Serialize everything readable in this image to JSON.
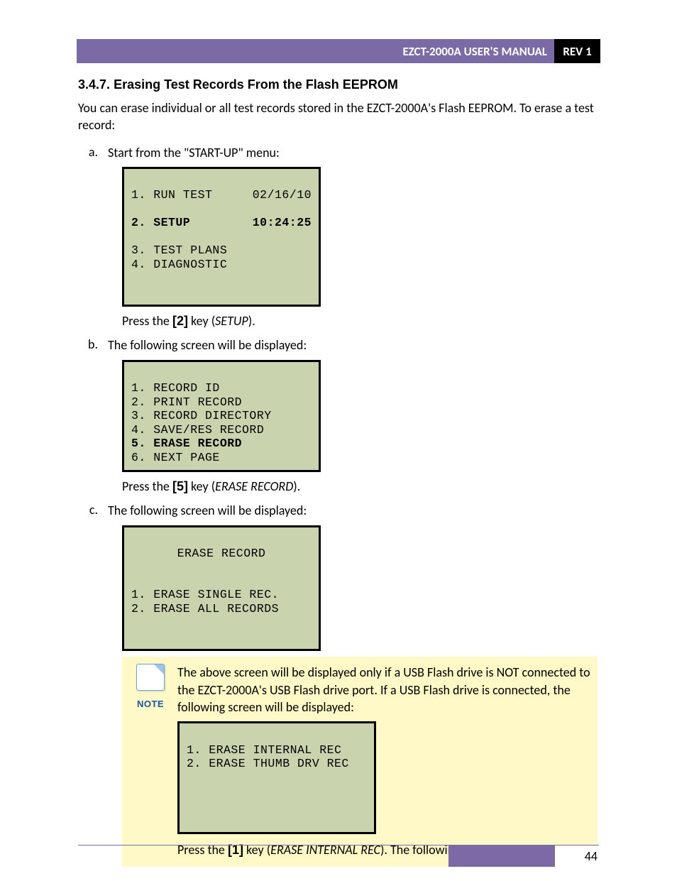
{
  "header": {
    "title": "EZCT-2000A USER'S MANUAL",
    "rev": "REV 1"
  },
  "section": {
    "number": "3.4.7.",
    "title": "Erasing Test Records From the Flash EEPROM",
    "intro": "You can erase individual or all test records stored in the EZCT-2000A's Flash EEPROM. To erase a test record:"
  },
  "stepA": {
    "letter": "a.",
    "text": "Start from the \"START-UP\" menu:",
    "lcd": {
      "l1_left": "1. RUN TEST",
      "l1_right": "02/16/10",
      "l2_left": "2. SETUP",
      "l2_right": "10:24:25",
      "l3": "3. TEST PLANS",
      "l4": "4. DIAGNOSTIC"
    },
    "after_pre": "Press the ",
    "after_key": "[2]",
    "after_mid": " key (",
    "after_em": "SETUP",
    "after_post": ")."
  },
  "stepB": {
    "letter": "b.",
    "text": "The following screen will be displayed:",
    "lcd": {
      "l1": "1. RECORD ID",
      "l2": "2. PRINT RECORD",
      "l3": "3. RECORD DIRECTORY",
      "l4": "4. SAVE/RES RECORD",
      "l5": "5. ERASE RECORD",
      "l6": "6. NEXT PAGE"
    },
    "after_pre": "Press the ",
    "after_key": "[5]",
    "after_mid": " key (",
    "after_em": "ERASE RECORD",
    "after_post": ")."
  },
  "stepC": {
    "letter": "c.",
    "text": "The following screen will be displayed:",
    "lcd": {
      "title": "ERASE RECORD",
      "l1": "1. ERASE SINGLE REC.",
      "l2": "2. ERASE ALL RECORDS"
    }
  },
  "note": {
    "label": "NOTE",
    "text": "The above screen will be displayed only if a USB Flash drive is NOT connected to the EZCT-2000A's USB Flash drive port. If a USB Flash drive is connected, the following screen will be displayed:",
    "lcd": {
      "l1": "1. ERASE INTERNAL REC",
      "l2": "2. ERASE THUMB DRV REC"
    },
    "after_pre": "Press the ",
    "after_key": "[1]",
    "after_mid": " key (",
    "after_em": "ERASE INTERNAL REC",
    "after_post": "). The following screen will be displayed:"
  },
  "footer": {
    "page": "44"
  }
}
